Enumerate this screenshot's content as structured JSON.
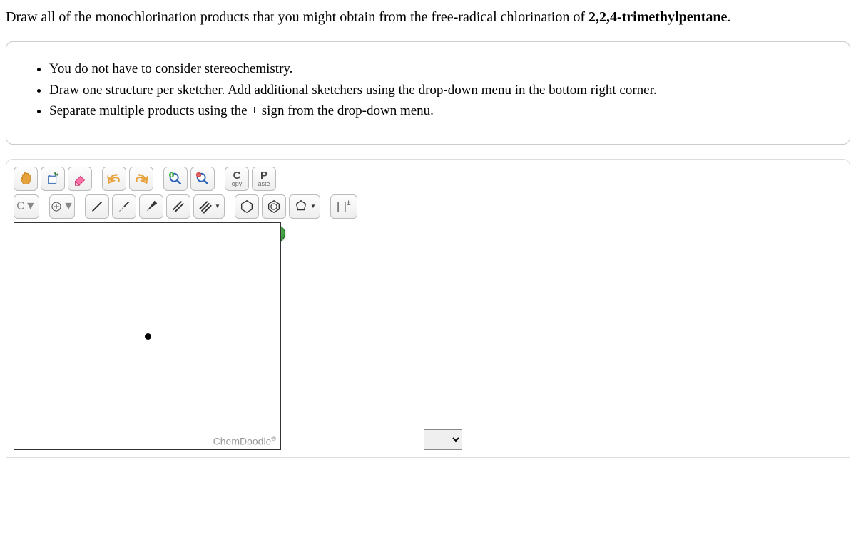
{
  "question": {
    "prefix": "Draw all of the monochlorination products that you might obtain from the free-radical chlorination of ",
    "bold": "2,2,4-trimethylpentane",
    "suffix": "."
  },
  "instructions": [
    "You do not have to consider stereochemistry.",
    "Draw one structure per sketcher. Add additional sketchers using the drop-down menu in the bottom right corner.",
    "Separate multiple products using the + sign from the drop-down menu."
  ],
  "toolbar": {
    "copy_big": "C",
    "copy_small": "opy",
    "paste_big": "P",
    "paste_small": "aste",
    "element_label": "C",
    "charge_label": "[ ]±",
    "help_label": "?"
  },
  "branding": {
    "name": "ChemDoodle",
    "reg": "®"
  }
}
